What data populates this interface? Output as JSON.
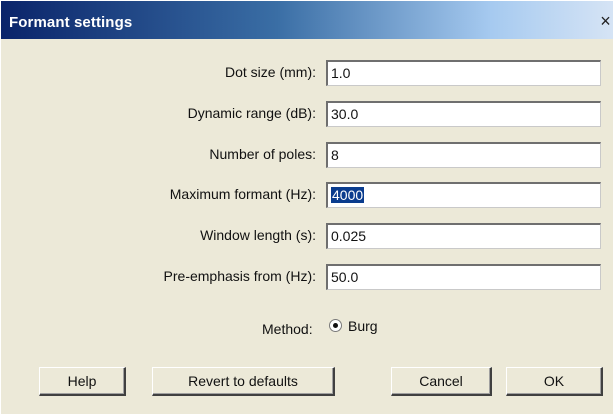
{
  "window": {
    "title": "Formant settings",
    "close_glyph": "×"
  },
  "fields": [
    {
      "label": "Dot size (mm):",
      "value": "1.0"
    },
    {
      "label": "Dynamic range (dB):",
      "value": "30.0"
    },
    {
      "label": "Number of poles:",
      "value": "8"
    },
    {
      "label": "Maximum formant (Hz):",
      "value": "4000",
      "selected": true
    },
    {
      "label": "Window length (s):",
      "value": "0.025"
    },
    {
      "label": "Pre-emphasis from (Hz):",
      "value": "50.0"
    }
  ],
  "method": {
    "label": "Method:",
    "option": "Burg",
    "checked": true
  },
  "buttons": {
    "help": "Help",
    "revert": "Revert to defaults",
    "cancel": "Cancel",
    "ok": "OK"
  }
}
